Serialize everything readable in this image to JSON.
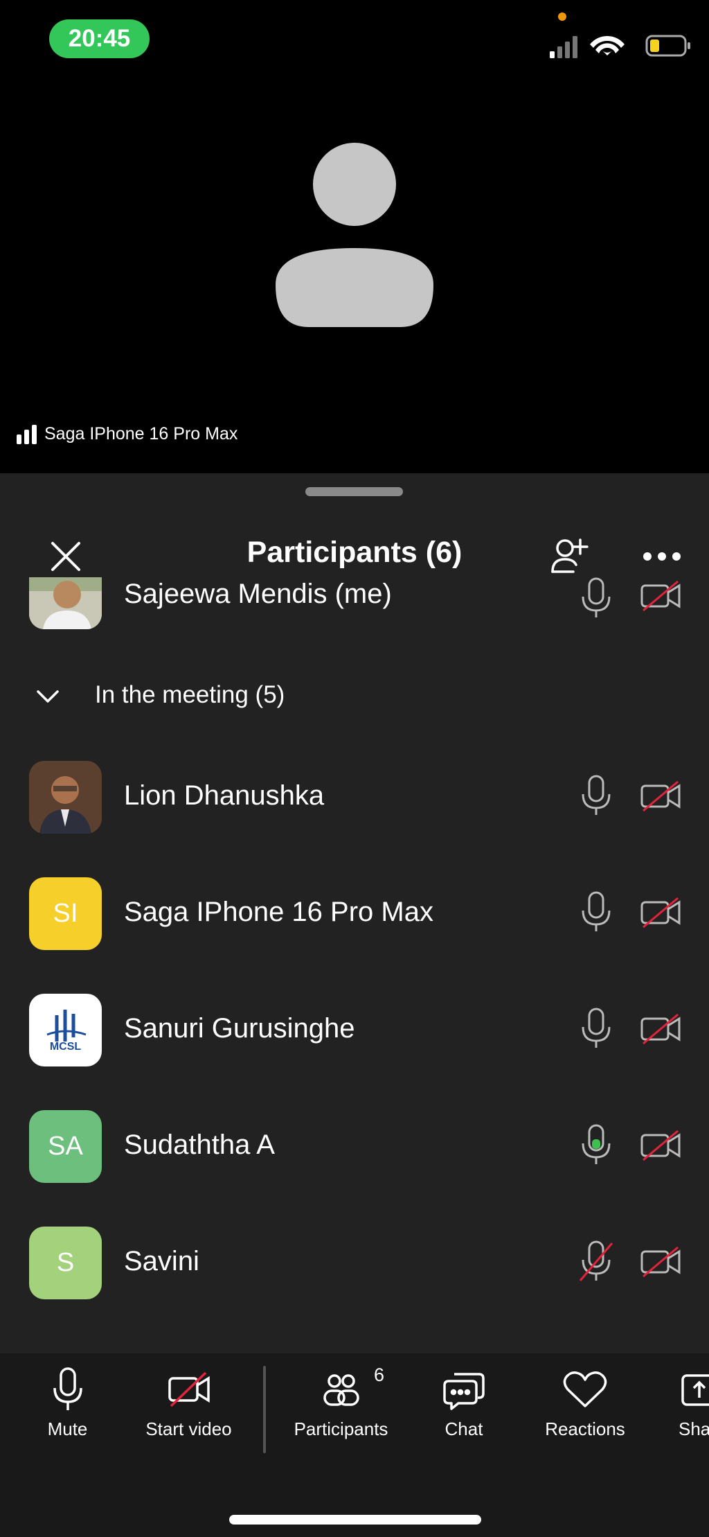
{
  "status_bar": {
    "time": "20:45"
  },
  "video": {
    "speaker_name": "Saga IPhone 16 Pro Max"
  },
  "panel": {
    "title": "Participants (6)",
    "me": {
      "name": "Sajeewa Mendis (me)"
    },
    "section_label": "In the meeting (5)",
    "participants": [
      {
        "name": "Lion Dhanushka",
        "initials": "",
        "avatar_color": "#5a3a2a"
      },
      {
        "name": "Saga IPhone 16 Pro Max",
        "initials": "SI",
        "avatar_color": "#f7cf2b"
      },
      {
        "name": "Sanuri Gurusinghe",
        "initials": "",
        "avatar_color": "#ffffff",
        "logo_text": "MCSL"
      },
      {
        "name": "Sudaththa A",
        "initials": "SA",
        "avatar_color": "#6cbf7d"
      },
      {
        "name": "Savini",
        "initials": "S",
        "avatar_color": "#a4d17c"
      }
    ]
  },
  "toolbar": {
    "mute": "Mute",
    "start_video": "Start video",
    "participants": "Participants",
    "participants_count": "6",
    "chat": "Chat",
    "reactions": "Reactions",
    "share": "Sha"
  },
  "colors": {
    "accent_green": "#33c75a",
    "muted_red": "#e0243c",
    "speaking_green": "#3fbf4f"
  }
}
